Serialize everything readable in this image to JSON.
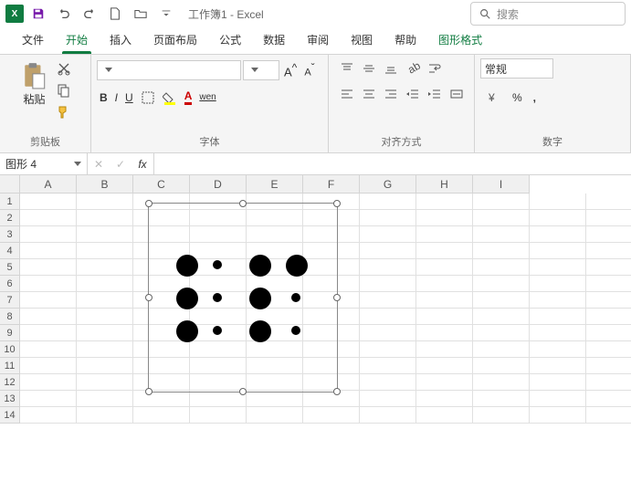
{
  "title": "工作簿1 - Excel",
  "search": {
    "placeholder": "搜索"
  },
  "tabs": {
    "file": "文件",
    "home": "开始",
    "insert": "插入",
    "layout": "页面布局",
    "formulas": "公式",
    "data": "数据",
    "review": "审阅",
    "view": "视图",
    "help": "帮助",
    "shapefmt": "图形格式"
  },
  "ribbon": {
    "paste": "粘贴",
    "clipboard_group": "剪贴板",
    "font_group": "字体",
    "align_group": "对齐方式",
    "number_group": "数字",
    "number_format": "常规",
    "bold": "B",
    "italic": "I",
    "underline": "U",
    "wen": "wen"
  },
  "namebox": "图形 4",
  "fx_label": "fx",
  "cols": [
    "A",
    "B",
    "C",
    "D",
    "E",
    "F",
    "G",
    "H",
    "I"
  ],
  "rows": [
    "1",
    "2",
    "3",
    "4",
    "5",
    "6",
    "7",
    "8",
    "9",
    "10",
    "11",
    "12",
    "13",
    "14"
  ]
}
